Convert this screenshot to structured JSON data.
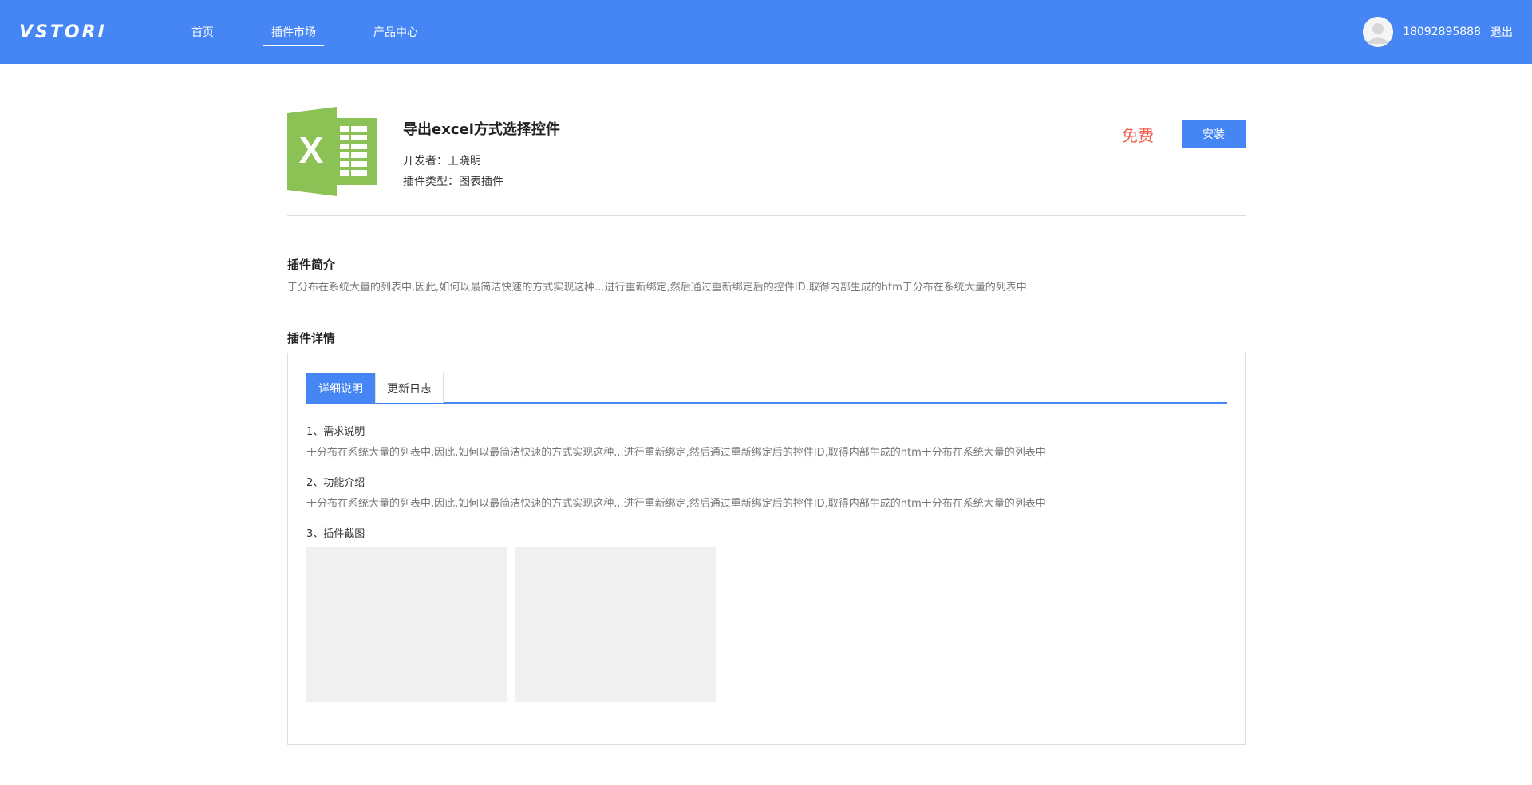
{
  "header": {
    "logo": "VSTORI",
    "nav": [
      {
        "label": "首页",
        "active": false
      },
      {
        "label": "插件市场",
        "active": true
      },
      {
        "label": "产品中心",
        "active": false
      }
    ],
    "user": {
      "phone": "18092895888",
      "logout": "退出",
      "avatar_icon": "user-avatar-icon"
    },
    "accent": "#4586f4"
  },
  "plugin": {
    "icon": "excel-icon",
    "icon_color": "#8bc155",
    "title": "导出excel方式选择控件",
    "developer": "开发者：王晓明",
    "type": "插件类型：图表插件",
    "price": "免费",
    "price_color": "#f05a4a",
    "install_label": "安装"
  },
  "intro": {
    "title": "插件简介",
    "text": "于分布在系统大量的列表中,因此,如何以最简洁快速的方式实现这种...进行重新绑定,然后通过重新绑定后的控件ID,取得内部生成的htm于分布在系统大量的列表中"
  },
  "details": {
    "title": "插件详情",
    "tabs": [
      {
        "label": "详细说明",
        "active": true
      },
      {
        "label": "更新日志",
        "active": false
      }
    ],
    "sections": [
      {
        "heading": "1、需求说明",
        "text": "于分布在系统大量的列表中,因此,如何以最简洁快速的方式实现这种...进行重新绑定,然后通过重新绑定后的控件ID,取得内部生成的htm于分布在系统大量的列表中"
      },
      {
        "heading": "2、功能介绍",
        "text": "于分布在系统大量的列表中,因此,如何以最简洁快速的方式实现这种...进行重新绑定,然后通过重新绑定后的控件ID,取得内部生成的htm于分布在系统大量的列表中"
      },
      {
        "heading": "3、插件截图"
      }
    ]
  }
}
